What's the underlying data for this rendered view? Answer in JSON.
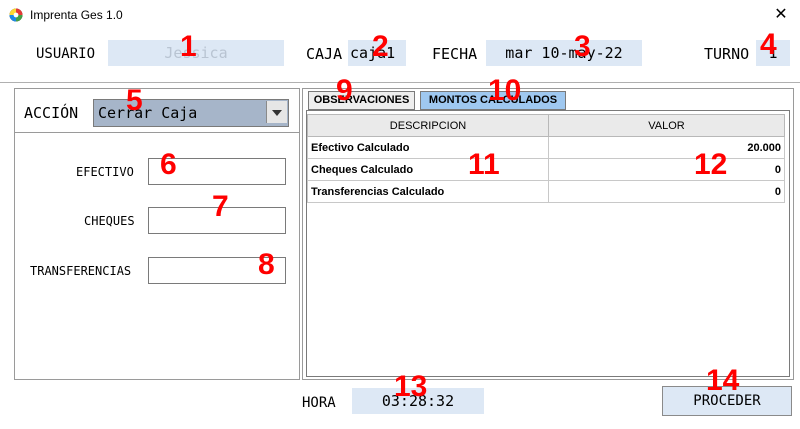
{
  "window": {
    "title": "Imprenta Ges 1.0",
    "close_glyph": "✕"
  },
  "header": {
    "usuario_label": "USUARIO",
    "usuario_value": "Jessica",
    "caja_label": "CAJA",
    "caja_value": "caja1",
    "fecha_label": "FECHA",
    "fecha_value": "mar 10-may-22",
    "turno_label": "TURNO",
    "turno_value": "1"
  },
  "left_panel": {
    "accion_label": "ACCIÓN",
    "accion_selected": "Cerrar Caja",
    "efectivo_label": "EFECTIVO",
    "efectivo_value": "",
    "cheques_label": "CHEQUES",
    "cheques_value": "",
    "transferencias_label": "TRANSFERENCIAS",
    "transferencias_value": ""
  },
  "tabs": [
    {
      "label": "OBSERVACIONES",
      "active": false
    },
    {
      "label": "MONTOS CALCULADOS",
      "active": true
    }
  ],
  "table": {
    "columns": [
      "DESCRIPCION",
      "VALOR"
    ],
    "rows": [
      {
        "descripcion": "Efectivo Calculado",
        "valor": "20.000"
      },
      {
        "descripcion": "Cheques Calculado",
        "valor": "0"
      },
      {
        "descripcion": "Transferencias Calculado",
        "valor": "0"
      }
    ]
  },
  "footer": {
    "hora_label": "HORA",
    "hora_value": "03:28:32",
    "proceder_label": "PROCEDER"
  },
  "annotations": [
    "1",
    "2",
    "3",
    "4",
    "5",
    "6",
    "7",
    "8",
    "9",
    "10",
    "11",
    "12",
    "13",
    "14"
  ],
  "colors": {
    "field_bg": "#dde8f5",
    "annotation": "#ff0000",
    "active_tab": "#9fc8f0"
  }
}
